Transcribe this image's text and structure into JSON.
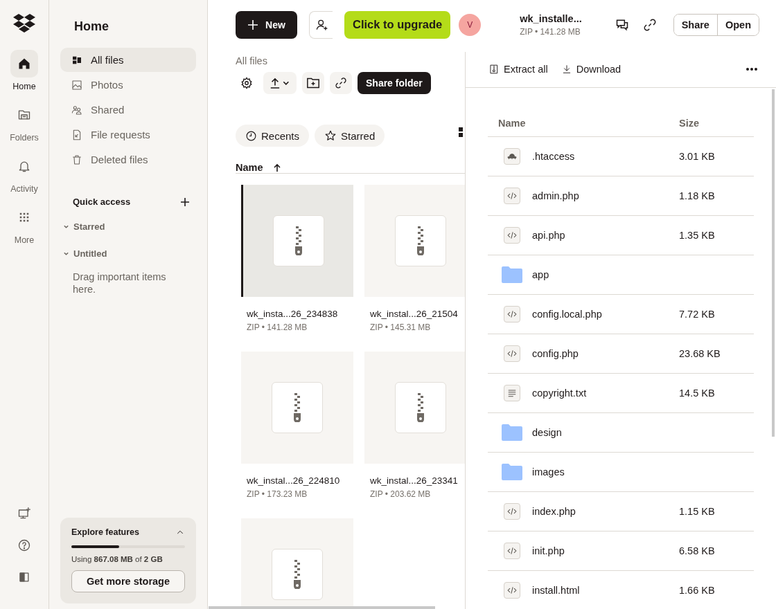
{
  "rail": {
    "items": [
      {
        "kind": "home",
        "label": "Home",
        "selected": true
      },
      {
        "kind": "folders",
        "label": "Folders",
        "selected": false
      },
      {
        "kind": "activity",
        "label": "Activity",
        "selected": false
      },
      {
        "kind": "more",
        "label": "More",
        "selected": false
      }
    ]
  },
  "sidebar": {
    "title": "Home",
    "items": [
      {
        "kind": "all",
        "label": "All files",
        "selected": true
      },
      {
        "kind": "photos",
        "label": "Photos",
        "selected": false
      },
      {
        "kind": "shared",
        "label": "Shared",
        "selected": false
      },
      {
        "kind": "requests",
        "label": "File requests",
        "selected": false
      },
      {
        "kind": "deleted",
        "label": "Deleted files",
        "selected": false
      }
    ],
    "quick_access": {
      "title": "Quick access",
      "sections": [
        {
          "label": "Starred",
          "expanded": true
        },
        {
          "label": "Untitled",
          "expanded": true
        }
      ],
      "empty_hint": "Drag important items here."
    },
    "storage_card": {
      "title": "Explore features",
      "level": 0.42,
      "usage_text": "Using **867.08 MB** of **2 GB**",
      "button": "Get more storage"
    }
  },
  "topbar": {
    "new_button": "New",
    "upgrade_button": "Click to upgrade",
    "avatar": "V",
    "file_title": "wk_installe...",
    "file_meta": "ZIP • 141.28 MB",
    "share_button": "Share",
    "open_button": "Open"
  },
  "main": {
    "breadcrumb": "All files",
    "share_folder_button": "Share folder",
    "filters": [
      "Recents",
      "Starred"
    ],
    "sort_column": "Name",
    "files": [
      {
        "name": "wk_insta...26_234838",
        "meta": "ZIP • 141.28 MB",
        "selected": true
      },
      {
        "name": "wk_instal...26_21504",
        "meta": "ZIP • 145.31 MB",
        "selected": false
      },
      {
        "name": "wk_instal...26_224810",
        "meta": "ZIP • 173.23 MB",
        "selected": false
      },
      {
        "name": "wk_instal...26_23341",
        "meta": "ZIP • 203.62 MB",
        "selected": false
      },
      {
        "selected": false
      }
    ]
  },
  "preview": {
    "actions": [
      "Extract all",
      "Download"
    ],
    "columns": [
      "Name",
      "Size"
    ],
    "rows": [
      {
        "kind": "config",
        "name": ".htaccess",
        "size": "3.01 KB"
      },
      {
        "kind": "code",
        "name": "admin.php",
        "size": "1.18 KB"
      },
      {
        "kind": "code",
        "name": "api.php",
        "size": "1.35 KB"
      },
      {
        "kind": "folder",
        "name": "app"
      },
      {
        "kind": "code",
        "name": "config.local.php",
        "size": "7.72 KB"
      },
      {
        "kind": "code",
        "name": "config.php",
        "size": "23.68 KB"
      },
      {
        "kind": "text",
        "name": "copyright.txt",
        "size": "14.5 KB"
      },
      {
        "kind": "folder",
        "name": "design"
      },
      {
        "kind": "folder",
        "name": "images"
      },
      {
        "kind": "code",
        "name": "index.php",
        "size": "1.15 KB"
      },
      {
        "kind": "code",
        "name": "init.php",
        "size": "6.58 KB"
      },
      {
        "kind": "code",
        "name": "install.html",
        "size": "1.66 KB"
      }
    ]
  }
}
